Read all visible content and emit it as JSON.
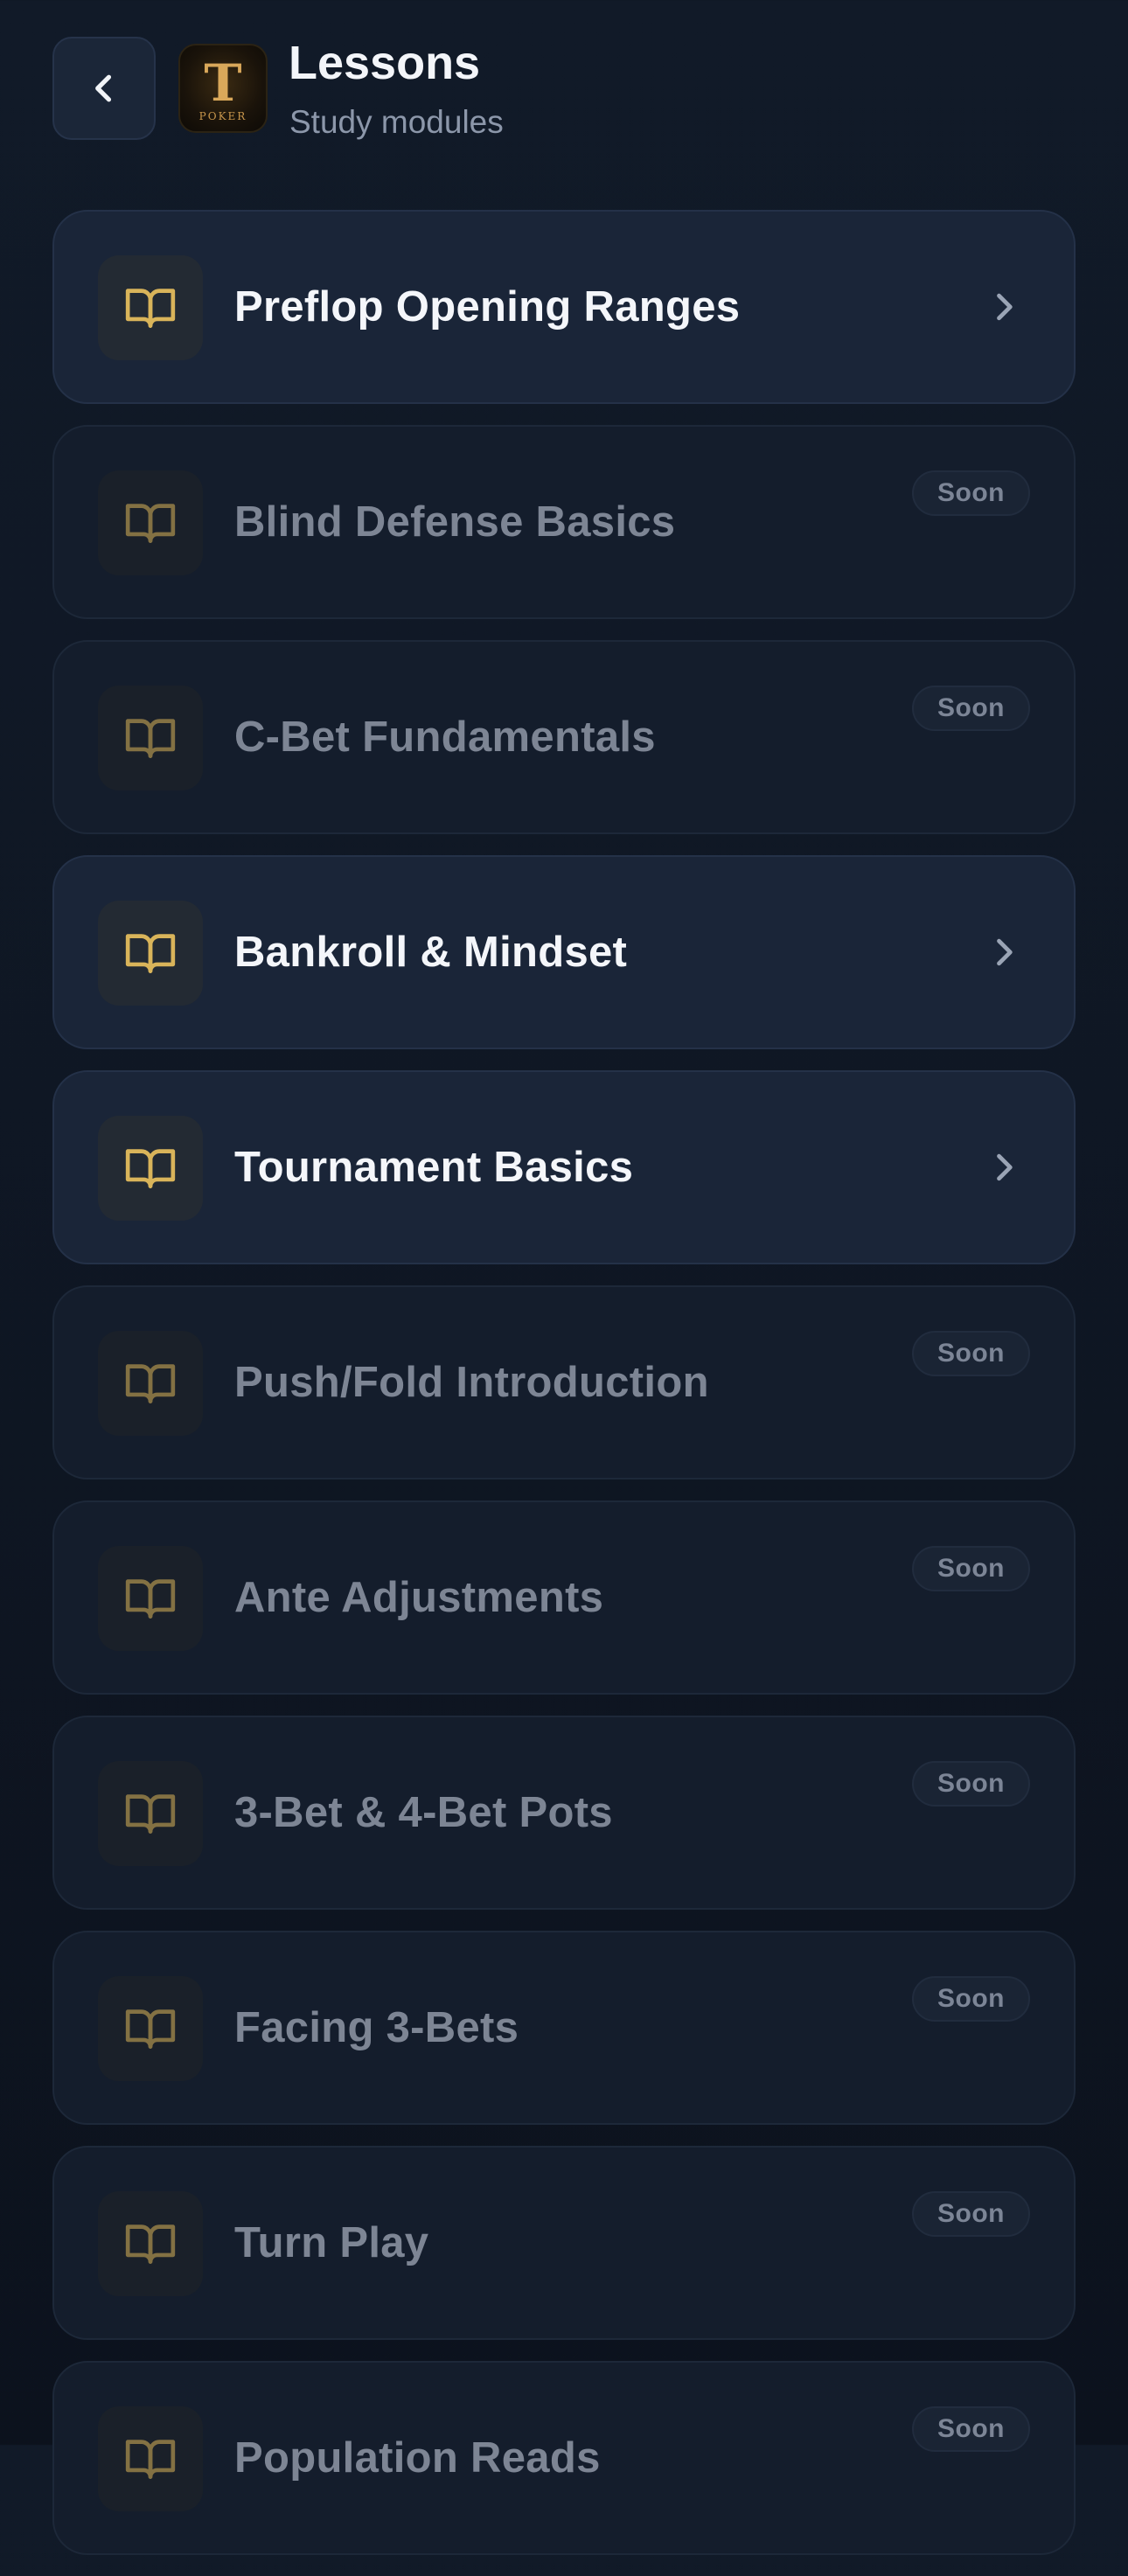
{
  "header": {
    "title": "Lessons",
    "subtitle": "Study modules",
    "back_icon": "chevron-left-icon",
    "logo": {
      "letter": "T",
      "text": "POKER"
    }
  },
  "colors": {
    "accent_gold": "#d9b45a",
    "card_active": "#1a2538",
    "card_locked": "#141d2c",
    "background": "#0f1724"
  },
  "lessons": [
    {
      "title": "Preflop Opening Ranges",
      "status": "available",
      "icon": "book-icon",
      "action_icon": "chevron-right-icon"
    },
    {
      "title": "Blind Defense Basics",
      "status": "locked",
      "icon": "book-icon",
      "badge": "Soon"
    },
    {
      "title": "C-Bet Fundamentals",
      "status": "locked",
      "icon": "book-icon",
      "badge": "Soon"
    },
    {
      "title": "Bankroll & Mindset",
      "status": "available",
      "icon": "book-icon",
      "action_icon": "chevron-right-icon"
    },
    {
      "title": "Tournament Basics",
      "status": "available",
      "icon": "book-icon",
      "action_icon": "chevron-right-icon"
    },
    {
      "title": "Push/Fold Introduction",
      "status": "locked",
      "icon": "book-icon",
      "badge": "Soon"
    },
    {
      "title": "Ante Adjustments",
      "status": "locked",
      "icon": "book-icon",
      "badge": "Soon"
    },
    {
      "title": "3-Bet & 4-Bet Pots",
      "status": "locked",
      "icon": "book-icon",
      "badge": "Soon"
    },
    {
      "title": "Facing 3-Bets",
      "status": "locked",
      "icon": "book-icon",
      "badge": "Soon"
    },
    {
      "title": "Turn Play",
      "status": "locked",
      "icon": "book-icon",
      "badge": "Soon"
    },
    {
      "title": "Population Reads",
      "status": "locked",
      "icon": "book-icon",
      "badge": "Soon"
    }
  ]
}
